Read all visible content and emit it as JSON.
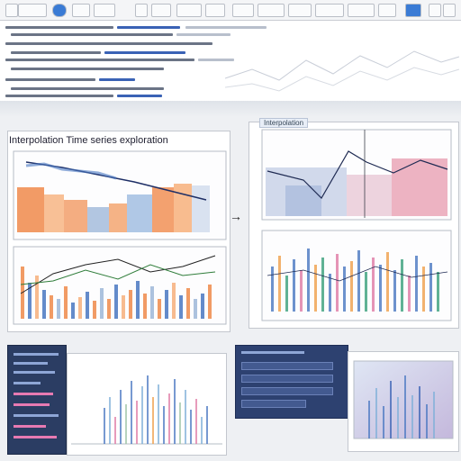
{
  "panels": {
    "left_heading": "Interpolation Time series exploration",
    "right_heading": "Interpolation"
  },
  "icons": [
    "back-icon",
    "forward-icon",
    "refresh-icon",
    "home-icon",
    "save-icon",
    "settings-icon"
  ],
  "colors": {
    "accent": "#3a62b5",
    "orange": "#f08a4b",
    "blue": "#4a78c2",
    "pink": "#e07aa5",
    "dark_panel": "#2b3d63"
  }
}
